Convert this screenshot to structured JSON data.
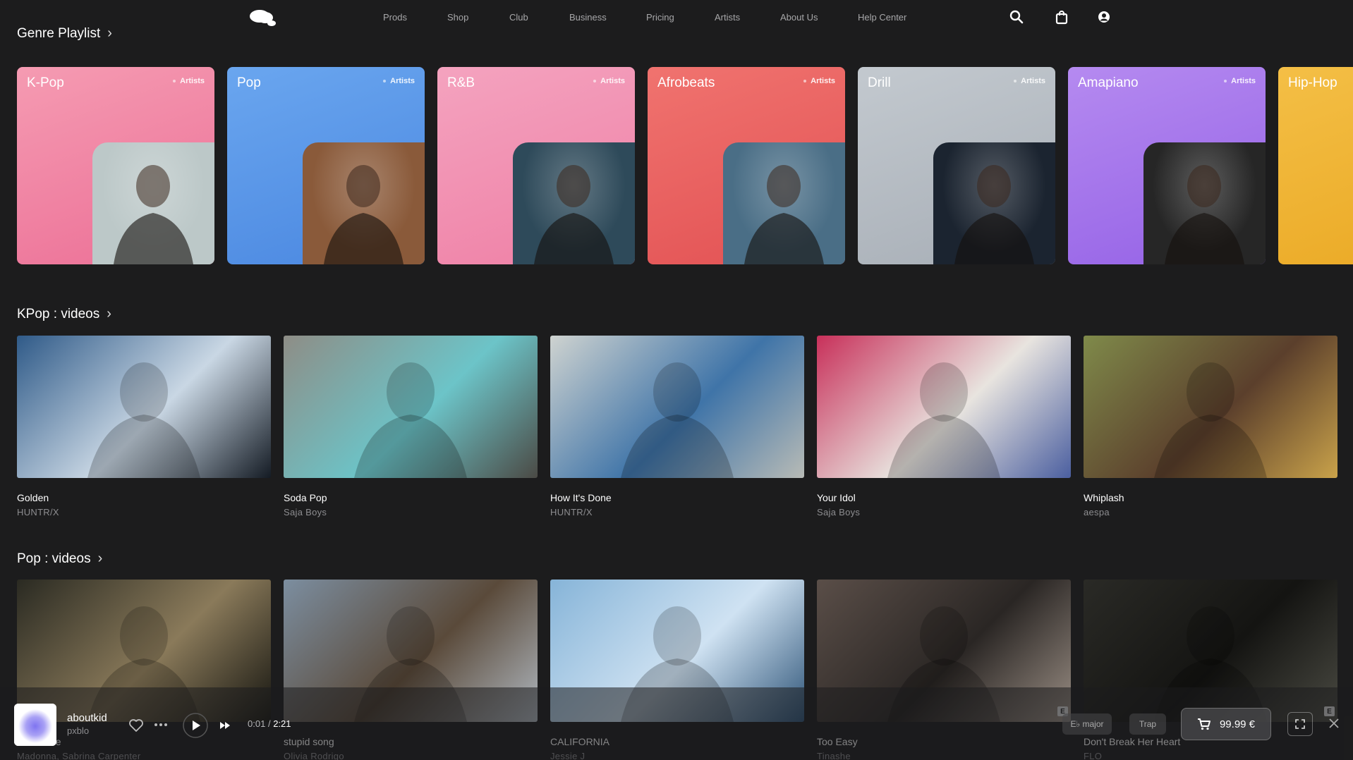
{
  "nav": {
    "logo": "cloud-logo",
    "links": [
      "Prods",
      "Shop",
      "Club",
      "Business",
      "Pricing",
      "Artists",
      "About Us",
      "Help Center"
    ],
    "icons": [
      "search-icon",
      "bag-icon",
      "account-icon"
    ]
  },
  "genre_section": {
    "title": "Genre Playlist",
    "cards": [
      {
        "name": "K-Pop",
        "tag": "Artists",
        "grad": [
          "#f59bb2",
          "#ec6f96"
        ],
        "photo_bg": "#bcc8c8"
      },
      {
        "name": "Pop",
        "tag": "Artists",
        "grad": [
          "#6aa6ef",
          "#4a87e0"
        ],
        "photo_bg": "#8a5a3a"
      },
      {
        "name": "R&B",
        "tag": "Artists",
        "grad": [
          "#f4a3bf",
          "#ef7fa5"
        ],
        "photo_bg": "#2e4a5a"
      },
      {
        "name": "Afrobeats",
        "tag": "Artists",
        "grad": [
          "#f0736f",
          "#e25153"
        ],
        "photo_bg": "#4a6e86"
      },
      {
        "name": "Drill",
        "tag": "Artists",
        "grad": [
          "#c3c9cf",
          "#a7aeb6"
        ],
        "photo_bg": "#1b2430"
      },
      {
        "name": "Amapiano",
        "tag": "Artists",
        "grad": [
          "#b58af0",
          "#9461e6"
        ],
        "photo_bg": "#262626"
      },
      {
        "name": "Hip-Hop",
        "tag": "Artists",
        "grad": [
          "#f4bf46",
          "#eaa823"
        ],
        "photo_bg": "#6a4a2a"
      }
    ]
  },
  "kpop_section": {
    "title": "KPop : videos",
    "videos": [
      {
        "title": "Golden",
        "artist": "HUNTR/X",
        "colors": [
          "#2f5a88",
          "#c9d7e4",
          "#141b24"
        ]
      },
      {
        "title": "Soda Pop",
        "artist": "Saja Boys",
        "colors": [
          "#8e8d86",
          "#6cc4c8",
          "#4b4a45"
        ]
      },
      {
        "title": "How It's Done",
        "artist": "HUNTR/X",
        "colors": [
          "#cfd3d0",
          "#3f74a8",
          "#b8bbb6"
        ]
      },
      {
        "title": "Your Idol",
        "artist": "Saja Boys",
        "colors": [
          "#c8305a",
          "#e8e4df",
          "#4b5fa0"
        ]
      },
      {
        "title": "Whiplash",
        "artist": "aespa",
        "colors": [
          "#7f8a4a",
          "#5b3f2c",
          "#c9a24a"
        ]
      }
    ]
  },
  "pop_section": {
    "title": "Pop : videos",
    "videos": [
      {
        "title": "Your Love",
        "artist": "Madonna, Sabrina Carpenter",
        "colors": [
          "#2a2a22",
          "#8a7a5a",
          "#151510"
        ]
      },
      {
        "title": "stupid song",
        "artist": "Olivia Rodrigo",
        "colors": [
          "#7c8ea0",
          "#5a4a3a",
          "#b0b8c0"
        ]
      },
      {
        "title": "CALIFORNIA",
        "artist": "Jessie J",
        "colors": [
          "#86b4d8",
          "#cfe2f2",
          "#2e5478"
        ]
      },
      {
        "title": "Too Easy",
        "artist": "Tinashe",
        "colors": [
          "#5a4e48",
          "#2a2624",
          "#9a8e84"
        ]
      },
      {
        "title": "Don't Break Her Heart",
        "artist": "FLO",
        "colors": [
          "#2a2a26",
          "#141412",
          "#4a4a42"
        ]
      }
    ]
  },
  "player": {
    "track": "aboutkid",
    "artist": "pxblo",
    "time_current": "0:01",
    "time_sep": "/",
    "time_total": "2:21",
    "key": "E♭ major",
    "genre": "Trap",
    "price": "99.99 €",
    "explicit": "E"
  }
}
